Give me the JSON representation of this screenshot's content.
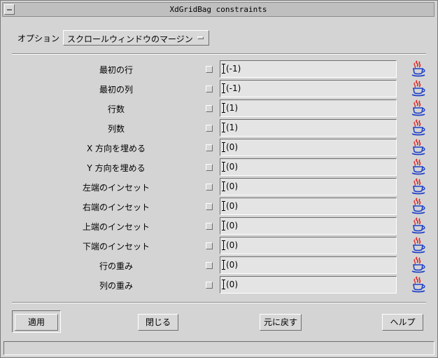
{
  "window": {
    "title": "XdGridBag constraints"
  },
  "option": {
    "label": "オプション",
    "selected": "スクロールウィンドウのマージン"
  },
  "rows": [
    {
      "label": "最初の行",
      "value": "(-1)"
    },
    {
      "label": "最初の列",
      "value": "(-1)"
    },
    {
      "label": "行数",
      "value": "(1)"
    },
    {
      "label": "列数",
      "value": "(1)"
    },
    {
      "label": "X 方向を埋める",
      "value": "(0)"
    },
    {
      "label": "Y 方向を埋める",
      "value": "(0)"
    },
    {
      "label": "左端のインセット",
      "value": "(0)"
    },
    {
      "label": "右端のインセット",
      "value": "(0)"
    },
    {
      "label": "上端のインセット",
      "value": "(0)"
    },
    {
      "label": "下端のインセット",
      "value": "(0)"
    },
    {
      "label": "行の重み",
      "value": "(0)"
    },
    {
      "label": "列の重み",
      "value": "(0)"
    }
  ],
  "row_icon": "java-coffee-cup-icon",
  "buttons": {
    "apply": "適用",
    "close": "閉じる",
    "revert": "元に戻す",
    "help": "ヘルプ"
  }
}
